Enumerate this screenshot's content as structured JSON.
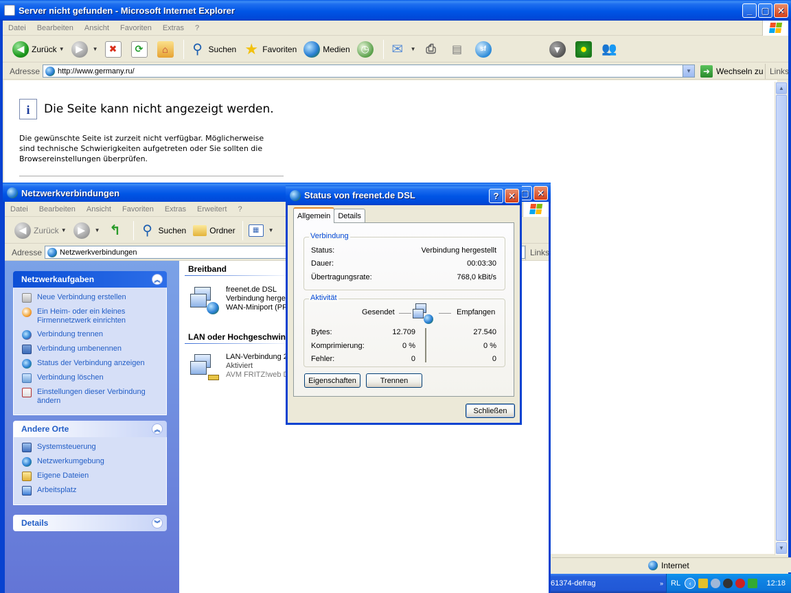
{
  "ie": {
    "title": "Server nicht gefunden - Microsoft Internet Explorer",
    "menu": [
      "Datei",
      "Bearbeiten",
      "Ansicht",
      "Favoriten",
      "Extras",
      "?"
    ],
    "toolbar": {
      "back": "Zurück",
      "search": "Suchen",
      "favorites": "Favoriten",
      "media": "Medien"
    },
    "address_label": "Adresse",
    "address": "http://www.germany.ru/",
    "go_label": "Wechseln zu",
    "links_label": "Links",
    "error_title": "Die Seite kann nicht angezeigt werden.",
    "error_text": "Die gewünschte Seite ist zurzeit nicht verfügbar. Möglicherweise sind technische Schwierigkeiten aufgetreten oder Sie sollten die Browsereinstellungen überprüfen.",
    "status_zone": "Internet"
  },
  "taskbar": {
    "task_label": "61374-defrag",
    "lang": "RL",
    "clock": "12:18"
  },
  "net": {
    "title": "Netzwerkverbindungen",
    "menu": [
      "Datei",
      "Bearbeiten",
      "Ansicht",
      "Favoriten",
      "Extras",
      "Erweitert",
      "?"
    ],
    "toolbar": {
      "back": "Zurück",
      "search": "Suchen",
      "folders": "Ordner"
    },
    "address_label": "Adresse",
    "address": "Netzwerkverbindungen",
    "links_label": "Links",
    "tasks_panel": {
      "title": "Netzwerkaufgaben",
      "items": [
        "Neue Verbindung erstellen",
        "Ein Heim- oder ein kleines Firmennetzwerk einrichten",
        "Verbindung trennen",
        "Verbindung umbenennen",
        "Status der Verbindung anzeigen",
        "Verbindung löschen",
        "Einstellungen dieser Verbindung ändern"
      ]
    },
    "places_panel": {
      "title": "Andere Orte",
      "items": [
        "Systemsteuerung",
        "Netzwerkumgebung",
        "Eigene Dateien",
        "Arbeitsplatz"
      ]
    },
    "details_panel": {
      "title": "Details"
    },
    "groups": {
      "broadband": "Breitband",
      "lan": "LAN oder Hochgeschwindigkeitsinternet"
    },
    "connections": {
      "dsl": {
        "name": "freenet.de DSL",
        "status": "Verbindung hergestellt",
        "device": "WAN-Miniport (PPPOE)"
      },
      "lan": {
        "name": "LAN-Verbindung 2",
        "status": "Aktiviert",
        "device": "AVM FRITZ!web DSL"
      }
    }
  },
  "dialog": {
    "title": "Status von freenet.de DSL",
    "tabs": [
      "Allgemein",
      "Details"
    ],
    "connection_group": "Verbindung",
    "status_label": "Status:",
    "status_value": "Verbindung hergestellt",
    "duration_label": "Dauer:",
    "duration_value": "00:03:30",
    "rate_label": "Übertragungsrate:",
    "rate_value": "768,0 kBit/s",
    "activity_group": "Aktivität",
    "sent_label": "Gesendet",
    "received_label": "Empfangen",
    "bytes_label": "Bytes:",
    "bytes_sent": "12.709",
    "bytes_received": "27.540",
    "compression_label": "Komprimierung:",
    "compression_sent": "0 %",
    "compression_received": "0 %",
    "errors_label": "Fehler:",
    "errors_sent": "0",
    "errors_received": "0",
    "properties_button": "Eigenschaften",
    "disconnect_button": "Trennen",
    "close_button": "Schließen"
  }
}
